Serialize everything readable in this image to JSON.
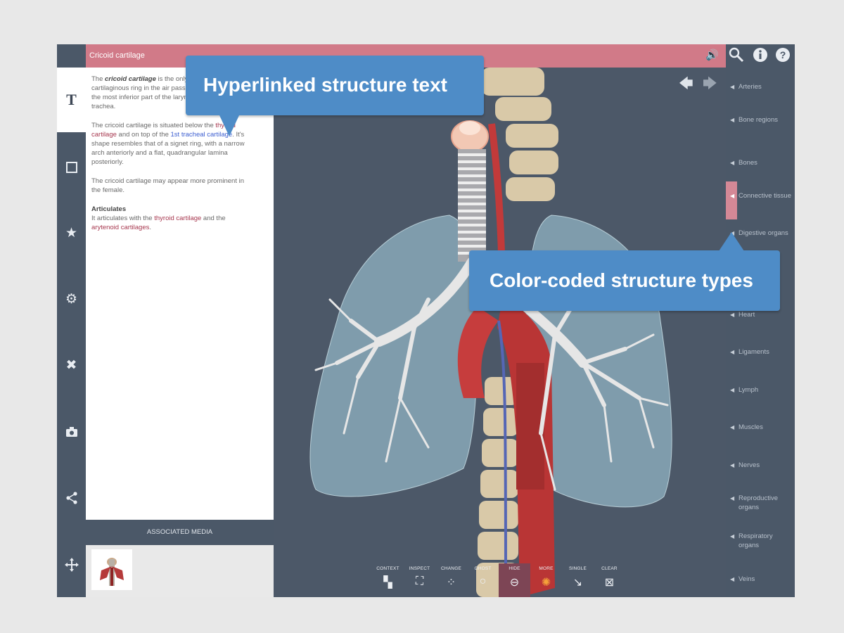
{
  "header": {
    "title": "Cricoid cartilage"
  },
  "textpanel": {
    "p1": {
      "a": "The ",
      "b": "cricoid cartilage",
      "c": " is the only complete cartilaginous ring in the air passages. It comprises the most inferior part of the larynx and supports the trachea."
    },
    "p2": {
      "a": "The cricoid cartilage is situated below the ",
      "link1": "thyroid cartilage",
      "b": " and on top of the ",
      "link2": "1st tracheal cartilage",
      "c": ". It's shape resembles that of a signet ring, with a narrow arch anteriorly and a flat, quadrangular lamina posteriorly."
    },
    "p3": "The cricoid cartilage may appear more prominent in the female.",
    "p4_title": "Articulates",
    "p4": {
      "a": "It articulates with the ",
      "link1": "thyroid cartilage",
      "b": " and the ",
      "link2": "arytenoid cartilages",
      "c": "."
    }
  },
  "media": {
    "label": "ASSOCIATED MEDIA"
  },
  "toolbar": [
    {
      "label": "CONTEXT",
      "icon": "context-icon"
    },
    {
      "label": "INSPECT",
      "icon": "inspect-icon"
    },
    {
      "label": "CHANGE",
      "icon": "change-icon"
    },
    {
      "label": "GHOST",
      "icon": "ghost-icon"
    },
    {
      "label": "HIDE",
      "icon": "hide-icon"
    },
    {
      "label": "MORE",
      "icon": "more-icon"
    },
    {
      "label": "SINGLE",
      "icon": "single-icon"
    },
    {
      "label": "CLEAR",
      "icon": "clear-icon"
    }
  ],
  "categories": [
    {
      "label": "Arteries"
    },
    {
      "label": "Bone regions"
    },
    {
      "label": "Bones"
    },
    {
      "label": "Connective tissue"
    },
    {
      "label": "Digestive organs"
    },
    {
      "label": "Heart"
    },
    {
      "label": "Ligaments"
    },
    {
      "label": "Lymph"
    },
    {
      "label": "Muscles"
    },
    {
      "label": "Nerves"
    },
    {
      "label": "Reproductive organs"
    },
    {
      "label": "Respiratory organs"
    },
    {
      "label": "Veins"
    }
  ],
  "callouts": {
    "one": "Hyperlinked structure text",
    "two": "Color-coded structure types"
  },
  "colors": {
    "header": "#d17a88",
    "chrome": "#4b5868",
    "callout": "#4e8cc7",
    "link_red": "#a7384f",
    "link_blue": "#3c5ed0"
  }
}
